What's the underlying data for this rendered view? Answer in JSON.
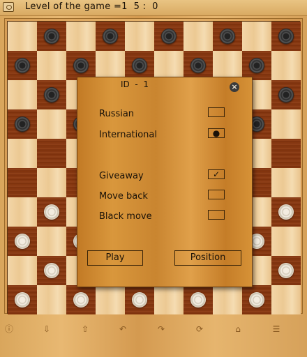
{
  "header": {
    "status_text": "Level of the game =1  5 :  0"
  },
  "board": {
    "size": 10,
    "pieces": [
      ".b.b.b.b.b",
      "b.b.b.b.b.",
      ".b.b.b.b.b",
      "b.b.b.b.b.",
      "..........",
      "..........",
      ".w.w.w.w.w",
      "w.w.w.w.w.",
      ".w.w.w.w.w",
      "w.w.w.w.w."
    ]
  },
  "dialog": {
    "title": "ID  -  1",
    "close_icon": "close-icon",
    "options": [
      {
        "label": "Russian",
        "mark": ""
      },
      {
        "label": "International",
        "mark": "●"
      },
      {
        "label": "Giveaway",
        "mark": "✓"
      },
      {
        "label": "Move back",
        "mark": ""
      },
      {
        "label": "Black move",
        "mark": ""
      }
    ],
    "play_label": "Play",
    "position_label": "Position"
  },
  "toolbar": {
    "icons": [
      "info-icon",
      "down-icon",
      "up-icon",
      "undo-icon",
      "redo-icon",
      "rotate-icon",
      "home-icon",
      "menu-icon"
    ]
  }
}
